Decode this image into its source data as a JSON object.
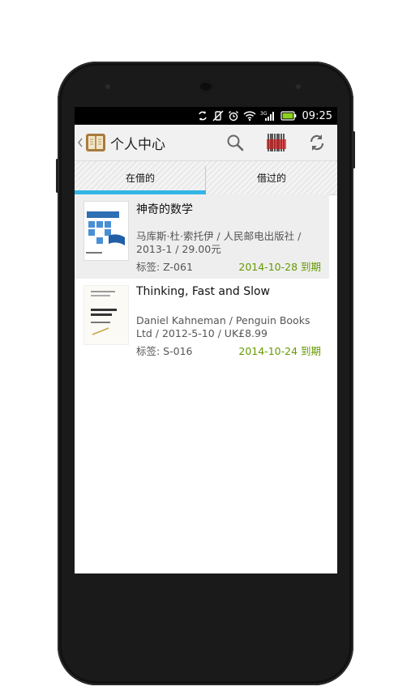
{
  "status_bar": {
    "time": "09:25",
    "icons": [
      "sync-icon",
      "vibrate-off-icon",
      "alarm-icon",
      "wifi-icon",
      "signal-icon",
      "battery-icon"
    ]
  },
  "action_bar": {
    "title": "个人中心",
    "buttons": [
      "search-icon",
      "barcode-scan-icon",
      "refresh-icon"
    ],
    "accent": "#33b5e5"
  },
  "tabs": [
    {
      "label": "在借的",
      "selected": true
    },
    {
      "label": "借过的",
      "selected": false
    }
  ],
  "books": [
    {
      "title": "神奇的数学",
      "meta": "马库斯·杜·索托伊 / 人民邮电出版社 / 2013-1 / 29.00元",
      "tag": "标签: Z-061",
      "due": "2014-10-28 到期",
      "cover_title": "神奇的数学",
      "cover_subtitle": "The Number Mysteries"
    },
    {
      "title": "Thinking, Fast and Slow",
      "meta": "Daniel Kahneman / Penguin Books Ltd / 2012-5-10 / UK£8.99",
      "tag": "标签: S-016",
      "due": "2014-10-24 到期",
      "cover_title": "Thinking, Fast and Slow",
      "cover_subtitle": "Daniel Kahneman"
    }
  ]
}
